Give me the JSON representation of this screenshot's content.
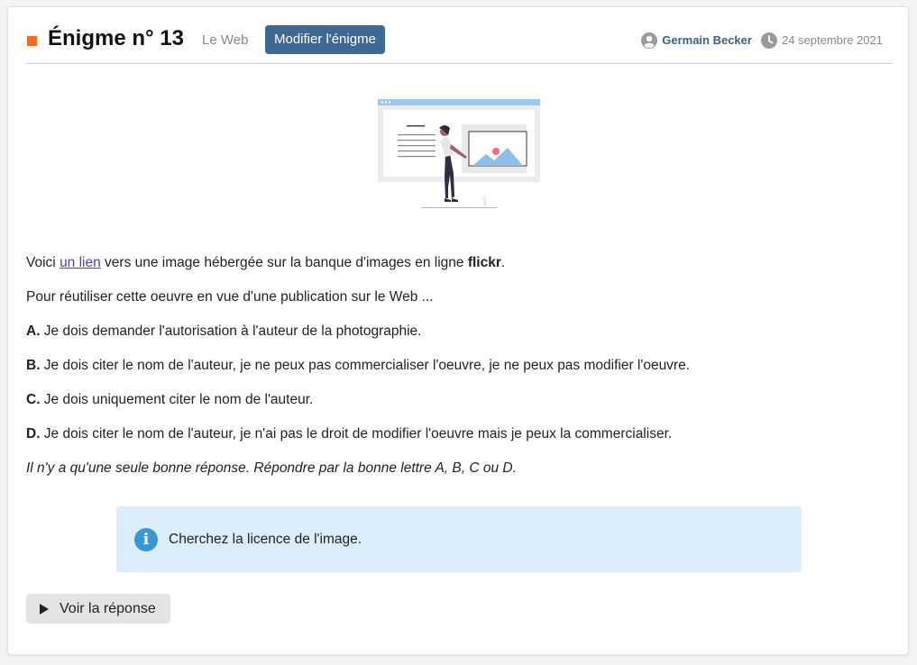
{
  "header": {
    "title": "Énigme n° 13",
    "category": "Le Web",
    "edit_label": "Modifier l'énigme",
    "author": "Germain Becker",
    "date": "24 septembre 2021",
    "accent_color": "#f26b21"
  },
  "body": {
    "intro_before": "Voici ",
    "intro_link": "un lien",
    "intro_after": " vers une image hébergée sur la banque d'images en ligne ",
    "intro_bold": "flickr",
    "intro_end": ".",
    "question": "Pour réutiliser cette oeuvre en vue d'une publication sur le Web ...",
    "options": [
      {
        "letter": "A.",
        "text": " Je dois demander l'autorisation à l'auteur de la photographie."
      },
      {
        "letter": "B.",
        "text": " Je dois citer le nom de l'auteur, je ne peux pas commercialiser l'oeuvre, je ne peux pas modifier l'oeuvre."
      },
      {
        "letter": "C.",
        "text": " Je dois uniquement citer le nom de l'auteur."
      },
      {
        "letter": "D.",
        "text": " Je dois citer le nom de l'auteur, je n'ai pas le droit de modifier l'oeuvre mais je peux la commercialiser."
      }
    ],
    "instruction": "Il n'y a qu'une seule bonne réponse. Répondre par la bonne lettre A, B, C ou D."
  },
  "hint": {
    "icon": "info-icon",
    "text": "Cherchez la licence de l'image."
  },
  "answer_button": {
    "icon": "play-icon",
    "label": "Voir la réponse"
  }
}
